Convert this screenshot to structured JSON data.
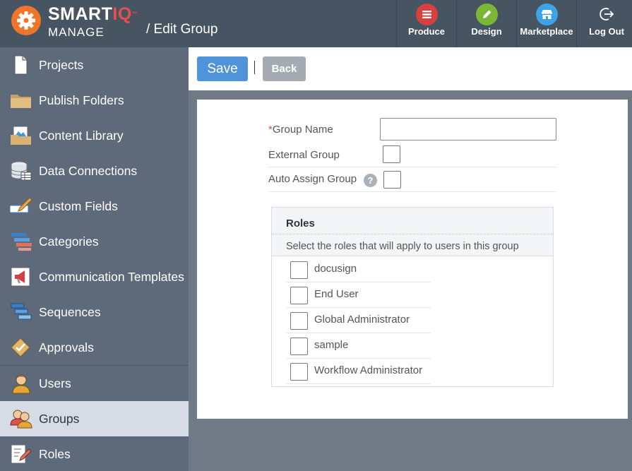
{
  "app": {
    "brand_smart": "SMART",
    "brand_iq": "IQ",
    "brand_tm": "™",
    "brand_sub": "MANAGE",
    "page_title": "/ Edit Group"
  },
  "topnav": [
    {
      "label": "Produce",
      "icon": "produce-icon",
      "color": "#d6413f"
    },
    {
      "label": "Design",
      "icon": "pencil-icon",
      "color": "#7ab833"
    },
    {
      "label": "Marketplace",
      "icon": "store-icon",
      "color": "#3da3e6"
    },
    {
      "label": "Log Out",
      "icon": "logout-icon",
      "color": "#475462"
    }
  ],
  "sidebar": {
    "items": [
      {
        "label": "Projects",
        "icon": "document-icon"
      },
      {
        "label": "Publish Folders",
        "icon": "folder-icon"
      },
      {
        "label": "Content Library",
        "icon": "image-folder-icon"
      },
      {
        "label": "Data Connections",
        "icon": "database-icon"
      },
      {
        "label": "Custom Fields",
        "icon": "edit-field-icon"
      },
      {
        "label": "Categories",
        "icon": "categories-icon"
      },
      {
        "label": "Communication Templates",
        "icon": "megaphone-icon"
      },
      {
        "label": "Sequences",
        "icon": "sequences-icon"
      },
      {
        "label": "Approvals",
        "icon": "approval-icon"
      },
      {
        "label": "Users",
        "icon": "user-icon"
      },
      {
        "label": "Groups",
        "icon": "group-icon",
        "active": true
      },
      {
        "label": "Roles",
        "icon": "roles-icon"
      }
    ]
  },
  "toolbar": {
    "save_label": "Save",
    "back_label": "Back"
  },
  "form": {
    "group_name_required": "*",
    "group_name_label": "Group Name",
    "group_name_value": "",
    "external_group_label": "External Group",
    "auto_assign_label": "Auto Assign Group",
    "help_glyph": "?"
  },
  "roles": {
    "title": "Roles",
    "subtitle": "Select the roles that will apply to users in this group",
    "items": [
      {
        "label": "docusign",
        "checked": false
      },
      {
        "label": "End User",
        "checked": false
      },
      {
        "label": "Global Administrator",
        "checked": false
      },
      {
        "label": "sample",
        "checked": false
      },
      {
        "label": "Workflow Administrator",
        "checked": false
      }
    ]
  },
  "colors": {
    "header_bg": "#475462",
    "sidebar_bg": "#5e6a7a",
    "sidebar_active": "#d6dce6",
    "save_button": "#4f93d9",
    "back_button": "#a5abb2",
    "logo_orange": "#f0752a",
    "required_red": "#d9534f"
  }
}
